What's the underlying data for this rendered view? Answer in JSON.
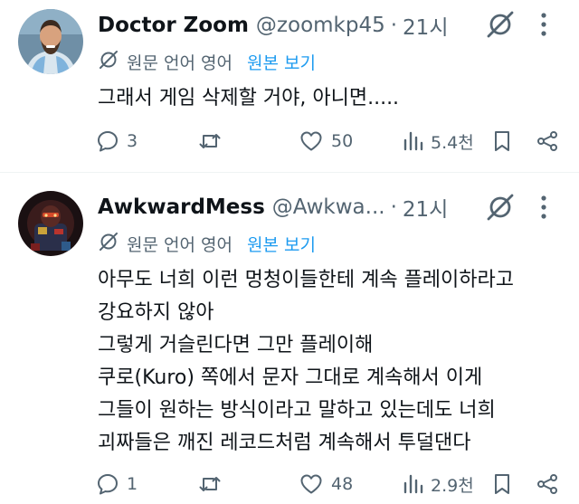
{
  "tweets": [
    {
      "author_name": "Doctor Zoom",
      "handle": "@zoomkp45",
      "separator": "·",
      "time": "21시",
      "translate": {
        "lang_label": "원문 언어 영어",
        "show_original": "원본 보기"
      },
      "text_lines": [
        "그래서 게임 삭제할 거야, 아니면....."
      ],
      "actions": {
        "replies": "3",
        "reposts": "",
        "likes": "50",
        "views": "5.4천"
      }
    },
    {
      "author_name": "AwkwardMess",
      "handle": "@Awkwa...",
      "separator": "·",
      "time": "21시",
      "translate": {
        "lang_label": "원문 언어 영어",
        "show_original": "원본 보기"
      },
      "text_lines": [
        "아무도 너희 이런 멍청이들한테 계속 플레이하라고",
        "강요하지 않아",
        "그렇게 거슬린다면 그만 플레이해",
        "쿠로(Kuro) 쪽에서 문자 그대로 계속해서 이게",
        "그들이 원하는 방식이라고 말하고 있는데도 너희",
        "괴짜들은 깨진 레코드처럼 계속해서 투덜댄다"
      ],
      "actions": {
        "replies": "1",
        "reposts": "",
        "likes": "48",
        "views": "2.9천"
      }
    }
  ],
  "colors": {
    "text": "#0f1419",
    "secondary": "#536471",
    "link": "#1d9bf0",
    "divider": "#eff3f4"
  }
}
